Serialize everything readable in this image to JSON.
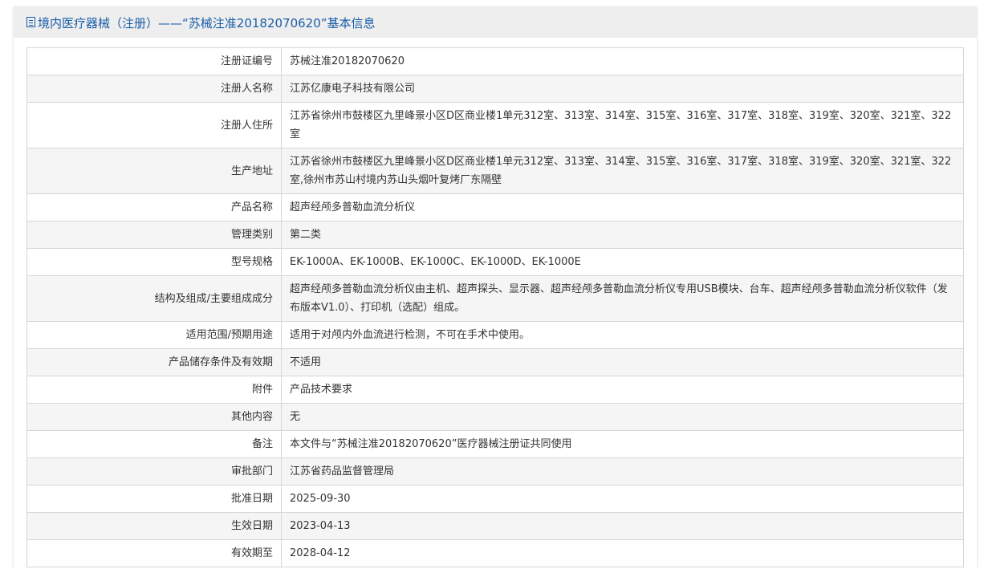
{
  "header": {
    "title": "境内医疗器械（注册）——“苏械注准20182070620”基本信息",
    "icon": "document-icon"
  },
  "rows": [
    {
      "label": "注册证编号",
      "value": "苏械注准20182070620"
    },
    {
      "label": "注册人名称",
      "value": "江苏亿康电子科技有限公司"
    },
    {
      "label": "注册人住所",
      "value": "江苏省徐州市鼓楼区九里峰景小区D区商业楼1单元312室、313室、314室、315室、316室、317室、318室、319室、320室、321室、322室"
    },
    {
      "label": "生产地址",
      "value": "江苏省徐州市鼓楼区九里峰景小区D区商业楼1单元312室、313室、314室、315室、316室、317室、318室、319室、320室、321室、322室,徐州市苏山村境内苏山头烟叶复烤厂东隔壁"
    },
    {
      "label": "产品名称",
      "value": "超声经颅多普勒血流分析仪"
    },
    {
      "label": "管理类别",
      "value": "第二类"
    },
    {
      "label": "型号规格",
      "value": "EK-1000A、EK-1000B、EK-1000C、EK-1000D、EK-1000E"
    },
    {
      "label": "结构及组成/主要组成成分",
      "value": "超声经颅多普勒血流分析仪由主机、超声探头、显示器、超声经颅多普勒血流分析仪专用USB模块、台车、超声经颅多普勒血流分析仪软件（发布版本V1.0）、打印机（选配）组成。"
    },
    {
      "label": "适用范围/预期用途",
      "value": "适用于对颅内外血流进行检测，不可在手术中使用。"
    },
    {
      "label": "产品储存条件及有效期",
      "value": "不适用"
    },
    {
      "label": "附件",
      "value": "产品技术要求"
    },
    {
      "label": "其他内容",
      "value": "无"
    },
    {
      "label": "备注",
      "value": "本文件与“苏械注准20182070620”医疗器械注册证共同使用"
    },
    {
      "label": "审批部门",
      "value": "江苏省药品监督管理局"
    },
    {
      "label": "批准日期",
      "value": "2025-09-30"
    },
    {
      "label": "生效日期",
      "value": "2023-04-13"
    },
    {
      "label": "有效期至",
      "value": "2028-04-12"
    }
  ]
}
